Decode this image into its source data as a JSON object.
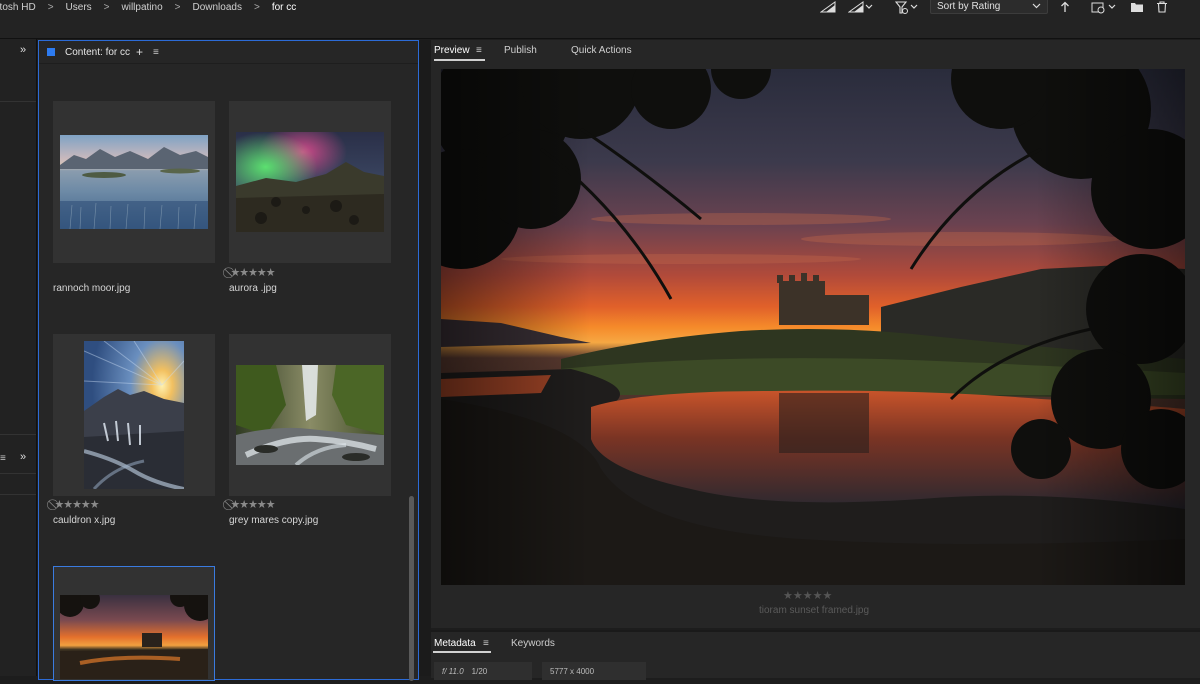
{
  "breadcrumb": {
    "items": [
      "ntosh HD",
      "Users",
      "willpatino",
      "Downloads",
      "for cc"
    ],
    "separator": ">"
  },
  "toolbar": {
    "sort_label": "Sort by Rating",
    "icons": [
      "quality-icon",
      "quality-options-icon",
      "filter-icon",
      "sort-icon",
      "sort-direction-icon",
      "recent-files-icon",
      "new-folder-icon",
      "delete-icon"
    ]
  },
  "left_panel": {
    "expand_glyph": "»",
    "menu_glyph": "≡"
  },
  "content_panel": {
    "title": "Content: for cc",
    "plus_glyph": "+",
    "menu_glyph": "≡",
    "items": [
      {
        "name": "rannoch moor.jpg",
        "stars": ""
      },
      {
        "name": "aurora .jpg",
        "stars": "⃠★★★★★"
      },
      {
        "name": "cauldron x.jpg",
        "stars": "⃠★★★★★"
      },
      {
        "name": "grey mares copy.jpg",
        "stars": "⃠★★★★★"
      },
      {
        "name": "tioram sunset framed.jpg",
        "stars": ""
      }
    ]
  },
  "preview_panel": {
    "tabs": [
      "Preview",
      "Publish",
      "Quick Actions"
    ],
    "active_tab": "Preview",
    "menu_glyph": "≡",
    "stars": "★★★★★",
    "filename": "tioram sunset framed.jpg"
  },
  "metadata_panel": {
    "tabs": [
      "Metadata",
      "Keywords"
    ],
    "menu_glyph": "≡",
    "aperture": "f/ 11.0",
    "shutter": "1/20",
    "dimensions": "5777 x 4000"
  },
  "colors": {
    "accent": "#2d7bf0",
    "panel_bg": "#262626",
    "app_bg": "#1d1d1d"
  }
}
